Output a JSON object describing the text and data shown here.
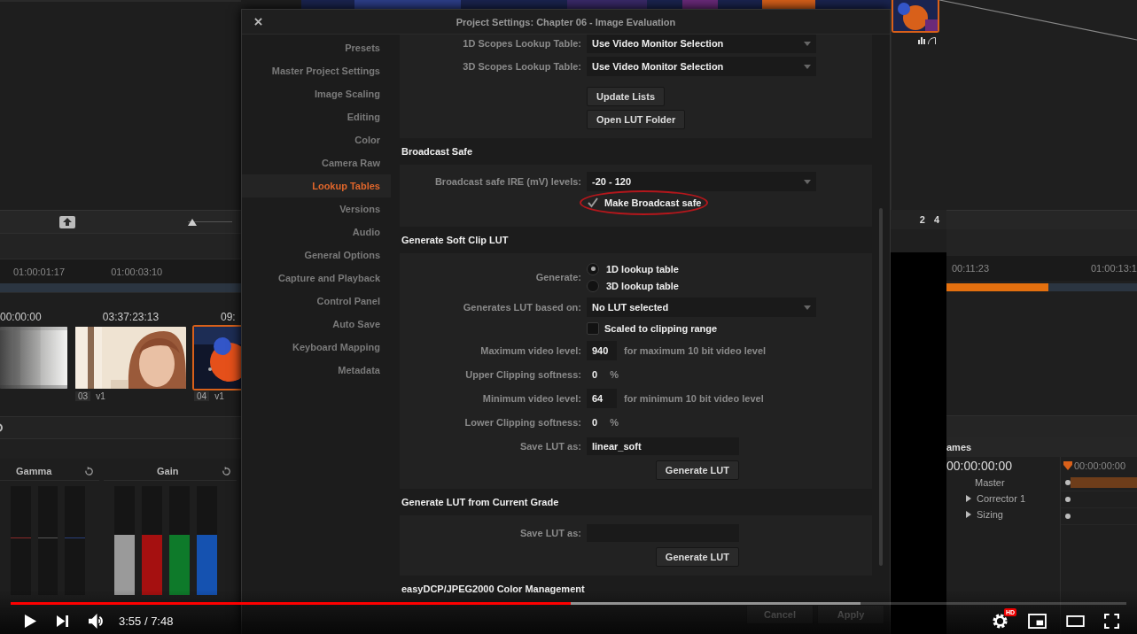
{
  "app": {
    "left_panel": {
      "zoom_slider": {
        "level": 0
      },
      "ruler": [
        "01:00:01:17",
        "01:00:03:10"
      ],
      "clips": [
        {
          "timecode": "00:00:00",
          "selected": false
        },
        {
          "timecode": "03:37:23:13",
          "number": "03",
          "track": "v1",
          "selected": false
        },
        {
          "timecode": "09:",
          "number": "04",
          "track": "v1",
          "selected": true
        }
      ],
      "wheels": [
        {
          "title": "Gamma",
          "kind": "lines",
          "channels": [
            {
              "color": "#8a2a2a",
              "level": 0.52
            },
            {
              "color": "#555555",
              "level": 0.52
            },
            {
              "color": "#2a3f7a",
              "level": 0.52
            }
          ]
        },
        {
          "title": "Gain",
          "kind": "bars",
          "channels": [
            {
              "color": "#9a9a9a",
              "level": 0.55
            },
            {
              "color": "#a51010",
              "level": 0.55
            },
            {
              "color": "#0e7a2a",
              "level": 0.55
            },
            {
              "color": "#1552b0",
              "level": 0.55
            }
          ]
        }
      ]
    },
    "right_panel": {
      "pages": [
        "2",
        "4"
      ],
      "ruler": [
        "00:11:23",
        "01:00:13:1"
      ],
      "render": {
        "level": 0.535
      },
      "keyframes": {
        "title": "ames",
        "timecode": "00:00:00:00",
        "ruler_timecode": "00:00:00:00",
        "tracks": [
          {
            "name": "Master",
            "expandable": false
          },
          {
            "name": "Corrector 1",
            "expandable": true
          },
          {
            "name": "Sizing",
            "expandable": true
          }
        ]
      }
    }
  },
  "dialog": {
    "title": "Project Settings: Chapter 06 - Image Evaluation",
    "sidebar": [
      {
        "label": "Presets",
        "selected": false
      },
      {
        "label": "Master Project Settings",
        "selected": false
      },
      {
        "label": "Image Scaling",
        "selected": false
      },
      {
        "label": "Editing",
        "selected": false
      },
      {
        "label": "Color",
        "selected": false
      },
      {
        "label": "Camera Raw",
        "selected": false
      },
      {
        "label": "Lookup Tables",
        "selected": true
      },
      {
        "label": "Versions",
        "selected": false
      },
      {
        "label": "Audio",
        "selected": false
      },
      {
        "label": "General Options",
        "selected": false
      },
      {
        "label": "Capture and Playback",
        "selected": false
      },
      {
        "label": "Control Panel",
        "selected": false
      },
      {
        "label": "Auto Save",
        "selected": false
      },
      {
        "label": "Keyboard Mapping",
        "selected": false
      },
      {
        "label": "Metadata",
        "selected": false
      }
    ],
    "sections": [
      {
        "rows": [
          {
            "kind": "dropdown",
            "label": "1D Scopes Lookup Table:",
            "value": "Use Video Monitor Selection"
          },
          {
            "kind": "dropdown",
            "label": "3D Scopes Lookup Table:",
            "value": "Use Video Monitor Selection"
          },
          {
            "kind": "button",
            "text": "Update Lists"
          },
          {
            "kind": "button",
            "text": "Open LUT Folder"
          }
        ]
      },
      {
        "title": "Broadcast Safe",
        "rows": [
          {
            "kind": "dropdown",
            "label": "Broadcast safe IRE (mV) levels:",
            "value": "-20 - 120"
          },
          {
            "kind": "checkbox",
            "text": "Make Broadcast safe",
            "checked": true,
            "circled": true
          }
        ]
      },
      {
        "title": "Generate Soft Clip LUT",
        "rows": [
          {
            "kind": "radio",
            "label": "Generate:",
            "options": [
              {
                "text": "1D lookup table",
                "selected": true
              },
              {
                "text": "3D lookup table",
                "selected": false
              }
            ]
          },
          {
            "kind": "dropdown",
            "label": "Generates LUT based on:",
            "value": "No LUT selected"
          },
          {
            "kind": "checkbox",
            "text": "Scaled to clipping range",
            "checked": false,
            "circled": false
          },
          {
            "kind": "spin",
            "label": "Maximum video level:",
            "value": "940",
            "note": "for maximum 10 bit video level"
          },
          {
            "kind": "percent",
            "label": "Upper Clipping softness:",
            "value": "0",
            "unit": "%"
          },
          {
            "kind": "spin",
            "label": "Minimum video level:",
            "value": "64",
            "note": "for minimum 10 bit video level"
          },
          {
            "kind": "percent",
            "label": "Lower Clipping softness:",
            "value": "0",
            "unit": "%"
          },
          {
            "kind": "text",
            "label": "Save LUT as:",
            "value": "linear_soft"
          },
          {
            "kind": "action",
            "text": "Generate LUT"
          }
        ]
      },
      {
        "title": "Generate LUT from Current Grade",
        "rows": [
          {
            "kind": "text",
            "label": "Save LUT as:"
          },
          {
            "kind": "action",
            "text": "Generate LUT"
          }
        ]
      },
      {
        "title": "easyDCP/JPEG2000 Color Management"
      }
    ],
    "buttons": [
      "Cancel",
      "Apply"
    ]
  },
  "player": {
    "progress": {
      "level": 0.502
    },
    "buffered": {
      "level": 0.762
    },
    "time": "3:55 / 7:48",
    "hd_badge": "HD"
  }
}
